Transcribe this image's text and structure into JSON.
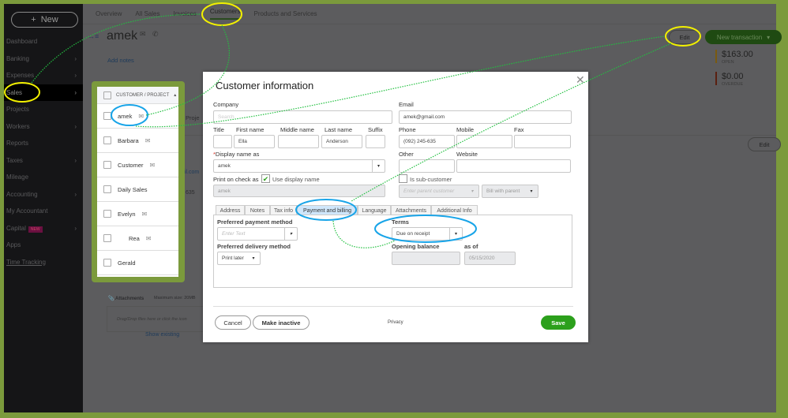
{
  "sidebar": {
    "new_label": "New",
    "items": [
      {
        "label": "Dashboard",
        "chev": false
      },
      {
        "label": "Banking",
        "chev": true
      },
      {
        "label": "Expenses",
        "chev": true
      },
      {
        "label": "Sales",
        "chev": true,
        "active": true
      },
      {
        "label": "Projects",
        "chev": false
      },
      {
        "label": "Workers",
        "chev": true
      },
      {
        "label": "Reports",
        "chev": false
      },
      {
        "label": "Taxes",
        "chev": true
      },
      {
        "label": "Mileage",
        "chev": false
      },
      {
        "label": "Accounting",
        "chev": true
      },
      {
        "label": "My Accountant",
        "chev": false
      },
      {
        "label": "Capital",
        "chev": true,
        "badge": "NEW"
      },
      {
        "label": "Apps",
        "chev": false
      },
      {
        "label": "Time Tracking",
        "chev": false
      }
    ]
  },
  "topnav": [
    "Overview",
    "All Sales",
    "Invoices",
    "Customers",
    "Products and Services"
  ],
  "customer": {
    "name": "amek",
    "add_notes": "Add notes",
    "edit": "Edit",
    "new_transaction": "New transaction",
    "open_amount": "$163.00",
    "open_label": "OPEN",
    "overdue_amount": "$0.00",
    "overdue_label": "OVERDUE",
    "edit2": "Edit",
    "email_partial": "ail.com",
    "phone_partial": "635",
    "projects_partial": "Proje",
    "attachments": "Attachments",
    "max_size": "Maximum size: 20MB",
    "drop": "Drag/Drop files here or click the icon",
    "show_existing": "Show existing"
  },
  "customer_list": {
    "header": "CUSTOMER / PROJECT",
    "rows": [
      {
        "name": "amek",
        "mail": true
      },
      {
        "name": "Barbara",
        "mail": true
      },
      {
        "name": "Customer",
        "mail": true
      },
      {
        "name": "Daily Sales",
        "mail": false
      },
      {
        "name": "Evelyn",
        "mail": true
      },
      {
        "name": "Rea",
        "mail": true
      },
      {
        "name": "Gerald",
        "mail": false
      }
    ]
  },
  "dialog": {
    "title": "Customer information",
    "company_label": "Company",
    "company_placeholder": "Search",
    "email_label": "Email",
    "email": "amek@gmail.com",
    "title_label": "Title",
    "first_label": "First name",
    "first": "Ella",
    "middle_label": "Middle name",
    "last_label": "Last name",
    "last": "Anderson",
    "suffix_label": "Suffix",
    "phone_label": "Phone",
    "phone": "(092) 245-635",
    "mobile_label": "Mobile",
    "fax_label": "Fax",
    "display_label": "Display name as",
    "display": "amek",
    "other_label": "Other",
    "website_label": "Website",
    "print_label": "Print on check as",
    "use_display": "Use display name",
    "print_value": "amek",
    "sub_customer": "Is sub-customer",
    "parent_placeholder": "Enter parent customer",
    "bill_with_parent": "Bill with parent",
    "tabs": [
      "Address",
      "Notes",
      "Tax info",
      "Payment and billing",
      "Language",
      "Attachments",
      "Additional Info"
    ],
    "pref_payment_label": "Preferred payment method",
    "pref_payment_placeholder": "Enter Text",
    "pref_delivery_label": "Preferred delivery method",
    "pref_delivery": "Print later",
    "terms_label": "Terms",
    "terms": "Due on receipt",
    "opening_label": "Opening balance",
    "as_of_label": "as of",
    "as_of": "05/15/2020",
    "cancel": "Cancel",
    "make_inactive": "Make inactive",
    "privacy": "Privacy",
    "save": "Save"
  },
  "colors": {
    "frame": "#7b9a3c",
    "save": "#2ca01c",
    "highlight_yellow": "#f2f000",
    "highlight_blue": "#18a4e8"
  }
}
